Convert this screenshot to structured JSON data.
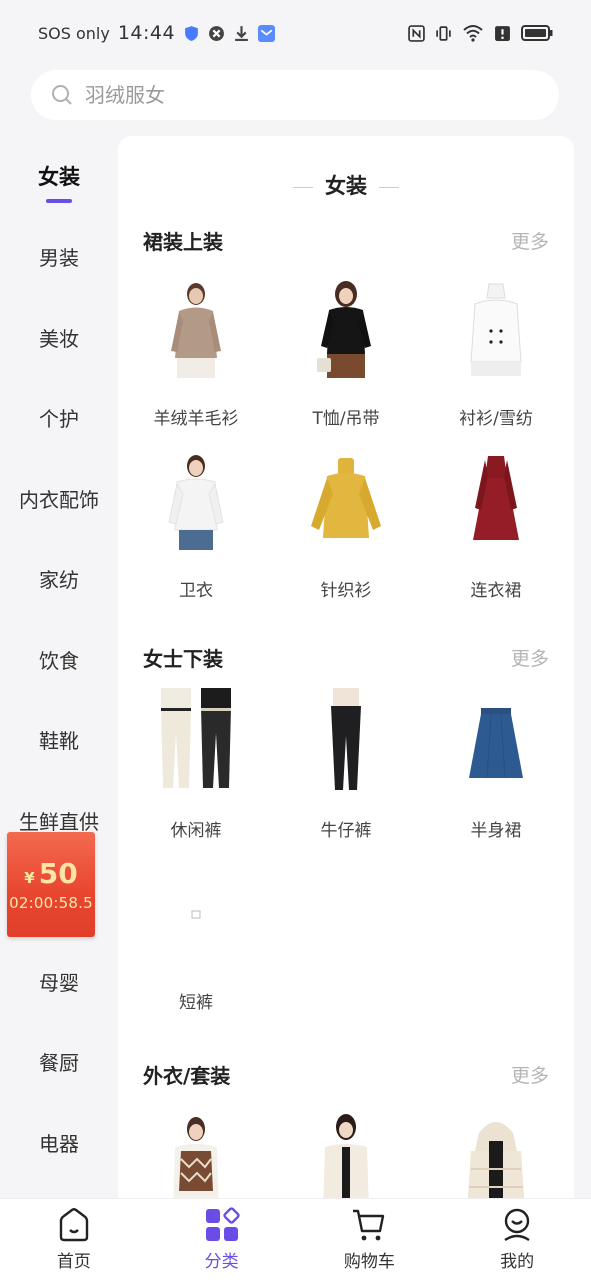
{
  "status_bar": {
    "carrier": "SOS only",
    "time": "14:44"
  },
  "search": {
    "placeholder": "羽绒服女"
  },
  "categories": [
    {
      "label": "女装"
    },
    {
      "label": "男装"
    },
    {
      "label": "美妆"
    },
    {
      "label": "个护"
    },
    {
      "label": "内衣配饰"
    },
    {
      "label": "家纺"
    },
    {
      "label": "饮食"
    },
    {
      "label": "鞋靴"
    },
    {
      "label": "生鲜直供"
    },
    {
      "label": ""
    },
    {
      "label": "母婴"
    },
    {
      "label": "餐厨"
    },
    {
      "label": "电器"
    }
  ],
  "active_category": "女装",
  "coupon": {
    "currency": "¥",
    "amount": "50",
    "countdown": "02:00:58.5"
  },
  "panel": {
    "title": "女装",
    "sections": [
      {
        "name": "裙装上装",
        "more": "更多",
        "items": [
          {
            "label": "羊绒羊毛衫"
          },
          {
            "label": "T恤/吊带"
          },
          {
            "label": "衬衫/雪纺"
          },
          {
            "label": "卫衣"
          },
          {
            "label": "针织衫"
          },
          {
            "label": "连衣裙"
          }
        ]
      },
      {
        "name": "女士下装",
        "more": "更多",
        "items": [
          {
            "label": "休闲裤"
          },
          {
            "label": "牛仔裤"
          },
          {
            "label": "半身裙"
          },
          {
            "label": "短裤"
          }
        ]
      },
      {
        "name": "外衣/套装",
        "more": "更多",
        "items": [
          {
            "label": ""
          },
          {
            "label": ""
          },
          {
            "label": ""
          }
        ]
      }
    ]
  },
  "tabbar": [
    {
      "label": "首页",
      "icon": "home-icon"
    },
    {
      "label": "分类",
      "icon": "category-icon"
    },
    {
      "label": "购物车",
      "icon": "cart-icon"
    },
    {
      "label": "我的",
      "icon": "profile-icon"
    }
  ],
  "colors": {
    "accent": "#6b4ce6",
    "background": "#f5f5f7",
    "coupon_red": "#e8452e",
    "coupon_text": "#ffe6a8"
  }
}
